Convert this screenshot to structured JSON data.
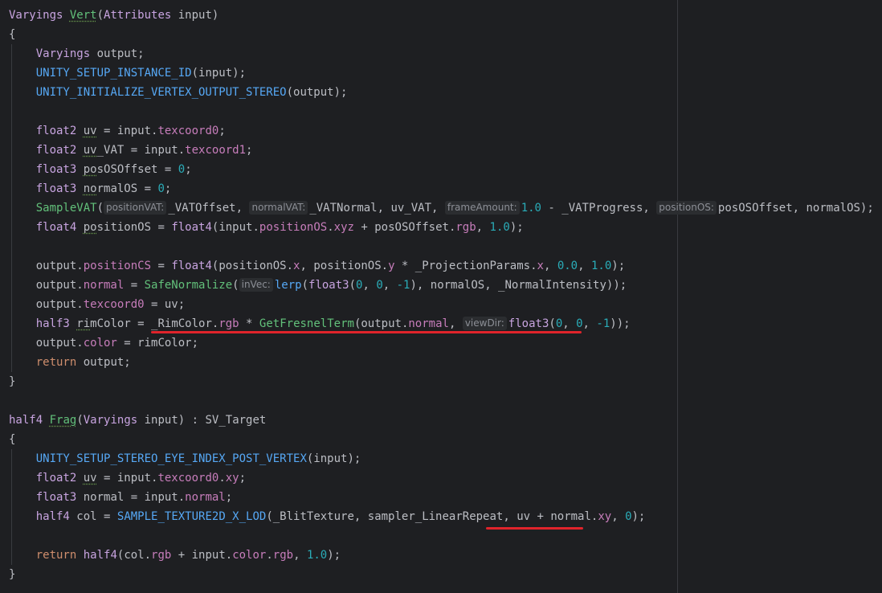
{
  "editor": {
    "colors": {
      "background": "#1e1f22",
      "annotation": "#e0242b"
    },
    "lines": [
      "Varyings Vert(Attributes input)",
      "{",
      "Varyings output;",
      "UNITY_SETUP_INSTANCE_ID(input);",
      "UNITY_INITIALIZE_VERTEX_OUTPUT_STEREO(output);",
      "",
      "float2 uv = input.texcoord0;",
      "float2 uv_VAT = input.texcoord1;",
      "float3 posOSOffset = 0;",
      "float3 normalOS = 0;",
      "SampleVAT(",
      "float4 positionOS = float4(input.positionOS.xyz + posOSOffset.rgb, 1.0);",
      "",
      "output.positionCS = float4(positionOS.x, positionOS.y * _ProjectionParams.x, 0.0, 1.0);",
      "output.normal = SafeNormalize(",
      "output.texcoord0 = uv;",
      "half3 rimColor = _RimColor.rgb * GetFresnelTerm(output.normal, ",
      "output.color = rimColor;",
      "return output;",
      "}",
      "",
      "half4 Frag(Varyings input) : SV_Target",
      "{",
      "UNITY_SETUP_STEREO_EYE_INDEX_POST_VERTEX(input);",
      "float2 uv = input.texcoord0.xy;",
      "float3 normal = input.normal;",
      "half4 col = SAMPLE_TEXTURE2D_X_LOD(_BlitTexture, sampler_LinearRepeat, uv + normal.xy, 0);",
      "",
      "return half4(col.rgb + input.color.rgb, 1.0);",
      "}"
    ],
    "sample_vat_rest": {
      "hint1": "positionVAT:",
      "arg1": "_VATOffset, ",
      "hint2": "normalVAT:",
      "arg2": "_VATNormal, uv_VAT, ",
      "hint3": "frameAmount:",
      "arg3": "1.0 - _VATProgress, ",
      "hint4": "positionOS:",
      "arg4": "posOSOffset, normalOS);"
    },
    "safe_normalize_rest": {
      "hint": "inVec:",
      "arg": "lerp(float3(0, 0, -1), normalOS, _NormalIntensity));"
    },
    "fresnel_rest": {
      "hint": "viewDir:",
      "arg": "float3(0, 0, -1));"
    }
  }
}
